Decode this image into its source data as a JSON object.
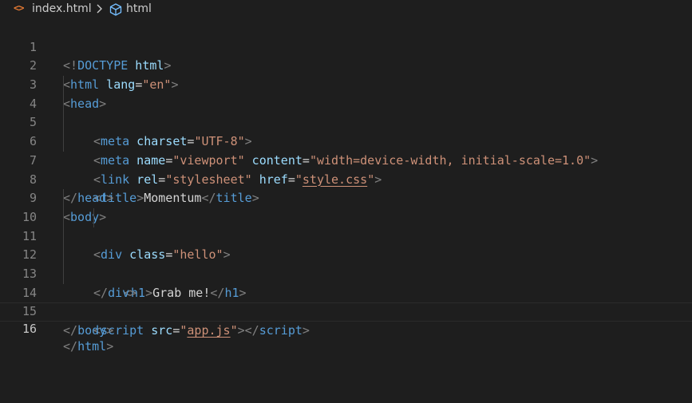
{
  "breadcrumb": {
    "file_icon": "<>",
    "file": "index.html",
    "separator_icon": "chevron-right-icon",
    "element_icon": "cube-icon",
    "element": "html"
  },
  "colors": {
    "background": "#1e1e1e",
    "punctuation": "#808080",
    "tag": "#569cd6",
    "attribute": "#9cdcfe",
    "string": "#ce9178",
    "text": "#d4d4d4",
    "line_number": "#858585",
    "file_icon": "#e37933"
  },
  "editor": {
    "current_line": 16,
    "lines": [
      {
        "n": "1",
        "s1": "<!",
        "t1": "DOCTYPE",
        "a1": " html",
        "s2": ">"
      },
      {
        "n": "2",
        "s1": "<",
        "t1": "html",
        "a1": " lang",
        "x1": "=",
        "v1": "\"en\"",
        "s2": ">"
      },
      {
        "n": "3",
        "s1": "<",
        "t1": "head",
        "s2": ">"
      },
      {
        "n": "4",
        "s1": "<",
        "t1": "meta",
        "a1": " charset",
        "x1": "=",
        "v1": "\"UTF-8\"",
        "s2": ">"
      },
      {
        "n": "5",
        "s1": "<",
        "t1": "meta",
        "a1": " name",
        "x1": "=",
        "v1": "\"viewport\"",
        "a2": " content",
        "x2": "=",
        "v2": "\"width=device-width, initial-scale=1.0\"",
        "s2": ">"
      },
      {
        "n": "6",
        "s1": "<",
        "t1": "link",
        "a1": " rel",
        "x1": "=",
        "v1": "\"stylesheet\"",
        "a2": " href",
        "x2": "=",
        "q1": "\"",
        "v2": "style.css",
        "q2": "\"",
        "s2": ">"
      },
      {
        "n": "7",
        "s1": "<",
        "t1": "title",
        "s2": ">",
        "text": "Momentum",
        "s3": "</",
        "t2": "title",
        "s4": ">"
      },
      {
        "n": "8",
        "s1": "</",
        "t1": "head",
        "s2": ">"
      },
      {
        "n": "9",
        "s1": "<",
        "t1": "body",
        "s2": ">"
      },
      {
        "n": "10",
        "s1": "<",
        "t1": "div",
        "a1": " class",
        "x1": "=",
        "v1": "\"hello\"",
        "s2": ">"
      },
      {
        "n": "11",
        "s1": "<",
        "t1": "h1",
        "s2": ">",
        "text": "Grab me!",
        "s3": "</",
        "t2": "h1",
        "s4": ">"
      },
      {
        "n": "12",
        "s1": "</",
        "t1": "div",
        "s2": ">"
      },
      {
        "n": "13"
      },
      {
        "n": "14",
        "s1": "<",
        "t1": "script",
        "a1": " src",
        "x1": "=",
        "q1": "\"",
        "v1": "app.js",
        "q2": "\"",
        "s2": "></",
        "t2": "script",
        "s3": ">"
      },
      {
        "n": "15",
        "s1": "</",
        "t1": "body",
        "s2": ">"
      },
      {
        "n": "16",
        "s1": "</",
        "t1": "html",
        "s2": ">"
      }
    ]
  }
}
